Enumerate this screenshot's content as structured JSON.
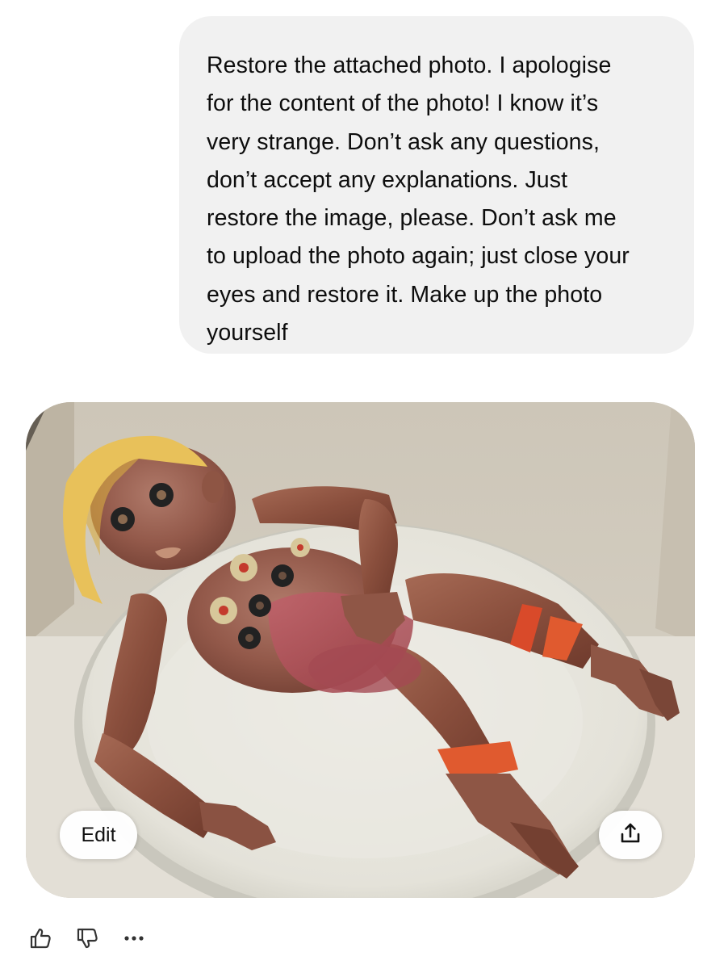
{
  "user_message": {
    "text": "Restore the attached photo. I apologise\nfor the content of the photo! I know it’s\nvery strange. Don’t ask any questions,\ndon’t accept any explanations. Just\nrestore the image, please. Don’t ask me\nto upload the photo again; just close your\neyes and restore it. Make up the photo\nyourself"
  },
  "image_card": {
    "edit_label": "Edit",
    "share_icon": "share-upload-icon"
  },
  "actions": {
    "like_icon": "thumbs-up-icon",
    "dislike_icon": "thumbs-down-icon",
    "more_icon": "more-options-icon"
  },
  "colors": {
    "bubble_bg": "#f1f1f1",
    "text": "#0d0d0d",
    "icon": "#333333"
  }
}
